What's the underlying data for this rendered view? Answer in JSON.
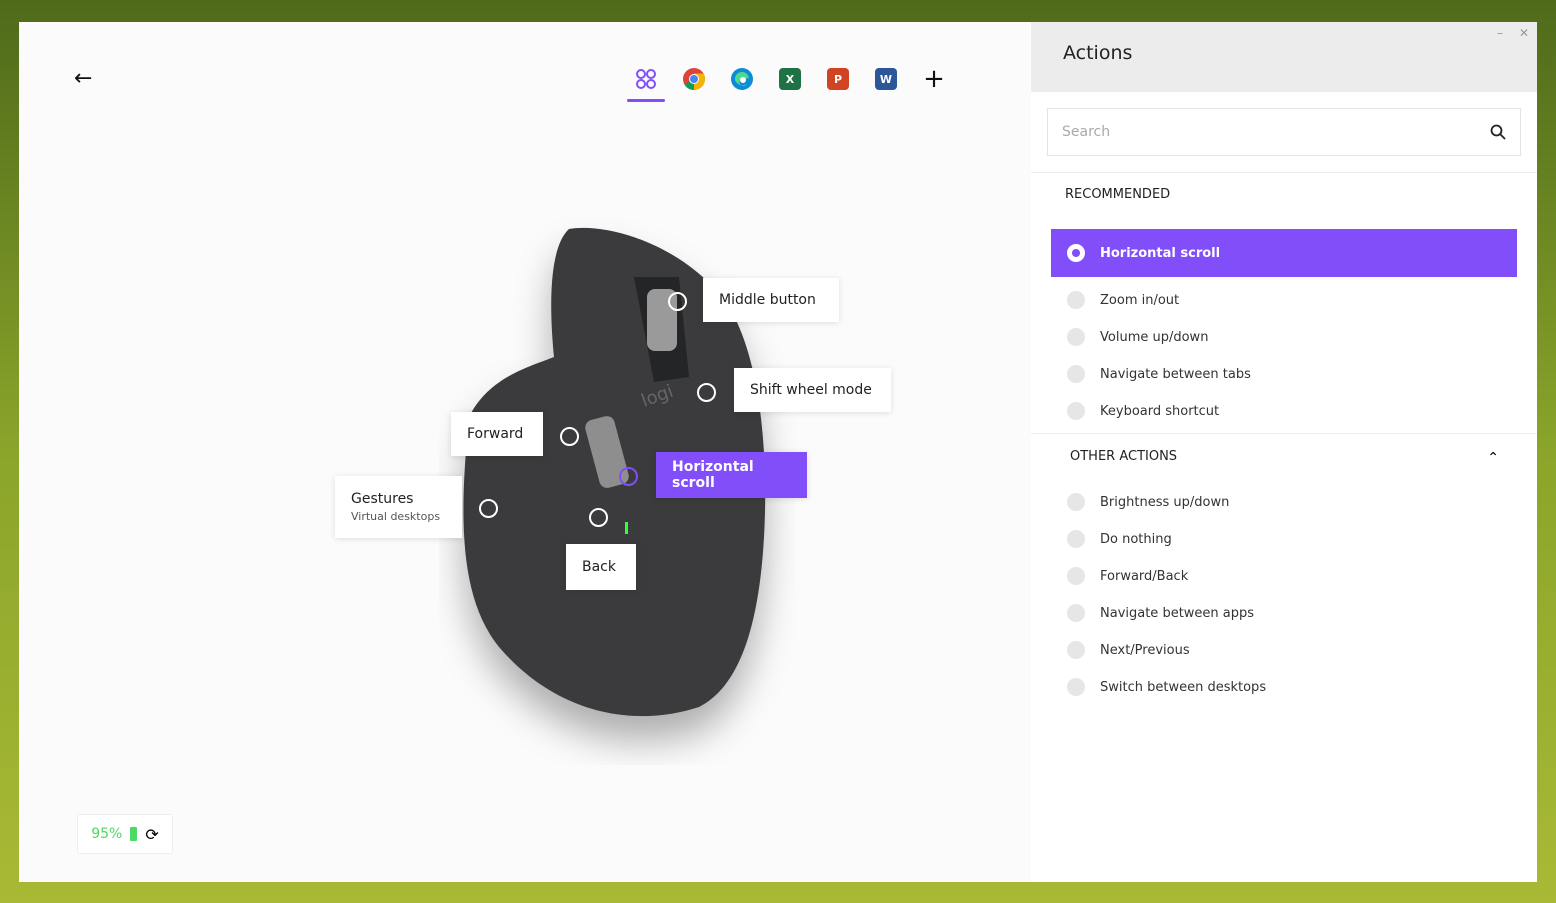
{
  "toolbar": {
    "apps": [
      {
        "name": "all-applications",
        "color": "#814efa"
      },
      {
        "name": "chrome",
        "color": "#4285f4"
      },
      {
        "name": "edge",
        "color": "#0c8bd6"
      },
      {
        "name": "excel",
        "color": "#1f7244",
        "letter": "X"
      },
      {
        "name": "powerpoint",
        "color": "#d04423",
        "letter": "P"
      },
      {
        "name": "word",
        "color": "#2b579a",
        "letter": "W"
      }
    ]
  },
  "mouse": {
    "labels": {
      "middle": "Middle button",
      "shift": "Shift wheel mode",
      "forward": "Forward",
      "horizontal": "Horizontal scroll",
      "gestures": "Gestures",
      "gestures_sub": "Virtual desktops",
      "back": "Back"
    },
    "logo": "logi"
  },
  "status": {
    "battery": "95%",
    "battery_color": "#4cd964"
  },
  "panel": {
    "title": "Actions",
    "search_placeholder": "Search",
    "recommended_title": "RECOMMENDED",
    "selected": "Horizontal scroll",
    "recommended": [
      "Zoom in/out",
      "Volume up/down",
      "Navigate between tabs",
      "Keyboard shortcut"
    ],
    "other_title": "OTHER ACTIONS",
    "other": [
      "Brightness up/down",
      "Do nothing",
      "Forward/Back",
      "Navigate between apps",
      "Next/Previous",
      "Switch between desktops"
    ]
  },
  "accent": "#814efa"
}
